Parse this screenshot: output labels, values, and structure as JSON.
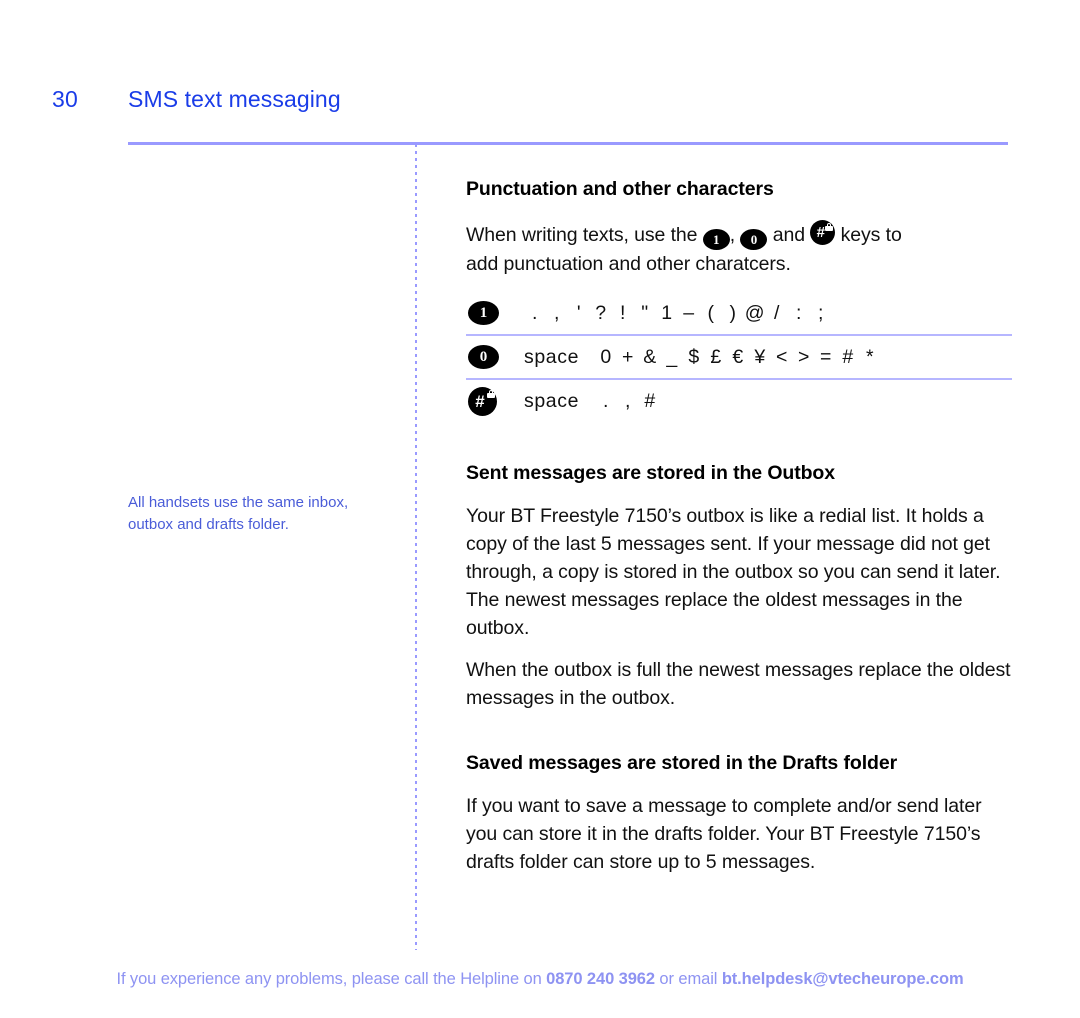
{
  "header": {
    "page_number": "30",
    "title": "SMS text messaging"
  },
  "margin_note": {
    "text": "All handsets use the same inbox, outbox and drafts folder."
  },
  "sections": {
    "punctuation": {
      "heading": "Punctuation and other characters",
      "intro_line1_before": "When writing texts, use the",
      "intro_comma": ",",
      "intro_and": "and",
      "intro_line1_after": "keys to",
      "intro_line2": "add punctuation and other charatcers.",
      "keys": {
        "one": "1",
        "zero": "0",
        "hash": "#"
      },
      "table": {
        "rows": [
          {
            "key": "1",
            "key_icon": "key-1-icon",
            "characters": [
              ".",
              ",",
              "'",
              "?",
              "!",
              "\"",
              "1",
              "–",
              "(",
              ")",
              "@",
              "/",
              ":",
              ";"
            ]
          },
          {
            "key": "0",
            "key_icon": "key-0-icon",
            "characters": [
              "space",
              "0",
              "+",
              "&",
              "_",
              "$",
              "£",
              "€",
              "¥",
              "<",
              ">",
              "=",
              "#",
              "*"
            ]
          },
          {
            "key": "#",
            "key_icon": "key-hash-lock-icon",
            "characters": [
              "space",
              ".",
              ",",
              "#"
            ]
          }
        ]
      }
    },
    "outbox": {
      "heading": "Sent messages are stored in the Outbox",
      "paragraph1": "Your BT Freestyle 7150’s outbox is like a redial list. It holds a copy of the last 5 messages sent. If your message did not get through, a copy is stored in the outbox so you can send it later. The newest messages replace the oldest messages in the outbox.",
      "paragraph2": "When the outbox is full the newest messages replace the oldest messages in the outbox."
    },
    "drafts": {
      "heading": "Saved messages are stored in the Drafts folder",
      "paragraph1": "If you want to save a message to complete and/or send later you can store it in the drafts folder. Your BT Freestyle 7150’s drafts folder can store up to 5 messages."
    }
  },
  "footer": {
    "text_before_phone": "If you experience any problems, please call the Helpline on ",
    "phone": "0870 240 3962",
    "text_between": " or email ",
    "email": "bt.helpdesk@vtecheurope.com"
  },
  "colors": {
    "heading_blue": "#1a3ce8",
    "rule_periwinkle": "#9a9aff",
    "note_blue": "#4a5cd8",
    "footer_blue": "#8e93f2",
    "key_black": "#000000"
  }
}
